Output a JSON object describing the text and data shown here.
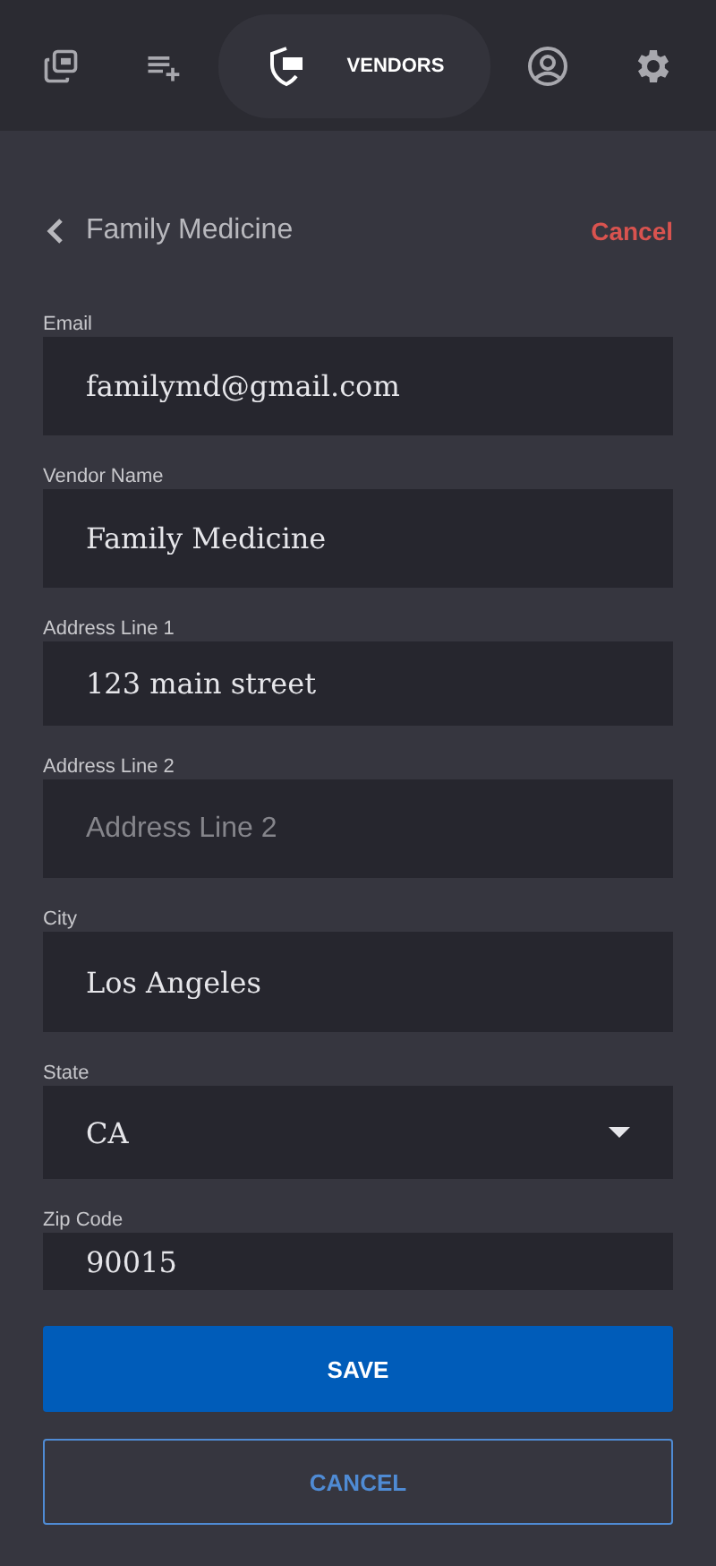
{
  "nav": {
    "tabs": [
      {
        "selected": false
      },
      {
        "selected": false
      },
      {
        "label": "VENDORS",
        "selected": true
      },
      {
        "selected": false
      },
      {
        "selected": false
      }
    ]
  },
  "header": {
    "title": "Family Medicine",
    "action": "Cancel"
  },
  "fields": [
    {
      "kind": "text",
      "label": "Email",
      "value": "familymd@gmail.com"
    },
    {
      "kind": "text",
      "label": "Vendor Name",
      "value": "Family Medicine"
    },
    {
      "kind": "text",
      "label": "Address Line 1",
      "value": "123 main street"
    },
    {
      "kind": "text",
      "label": "Address Line 2",
      "placeholder": "Address Line 2"
    },
    {
      "kind": "text",
      "label": "City",
      "value": "Los Angeles"
    },
    {
      "kind": "select",
      "label": "State",
      "value": "CA"
    },
    {
      "kind": "text",
      "label": "Zip Code",
      "value": "90015"
    }
  ],
  "buttons": [
    {
      "kind": "primary",
      "label": "SAVE"
    },
    {
      "kind": "outline",
      "label": "CANCEL"
    }
  ]
}
